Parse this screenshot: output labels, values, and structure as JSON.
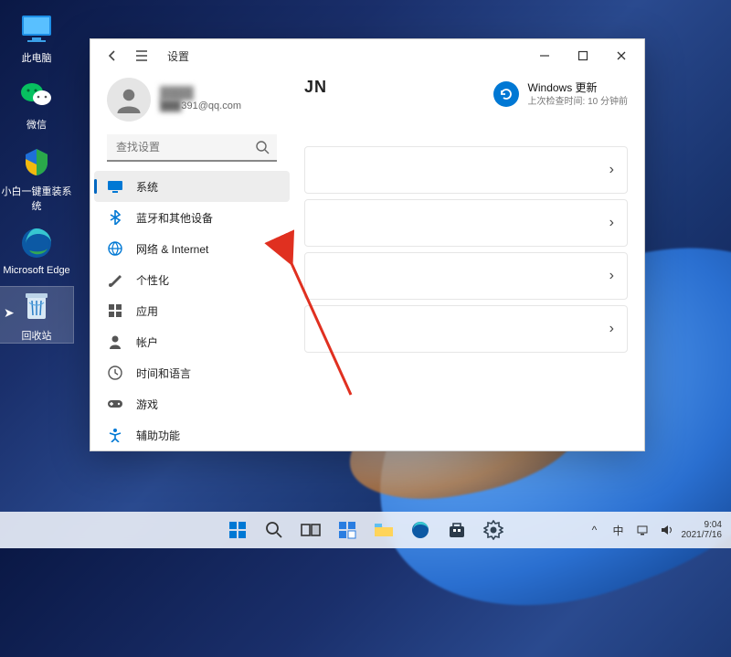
{
  "desktop": {
    "icons": [
      {
        "label": "此电脑"
      },
      {
        "label": "微信"
      },
      {
        "label": "小白一键重装系统"
      },
      {
        "label": "Microsoft Edge"
      },
      {
        "label": "回收站"
      }
    ]
  },
  "window": {
    "title": "设置",
    "profile": {
      "name_masked": "████",
      "email_suffix": "391@qq.com"
    },
    "search_placeholder": "查找设置",
    "nav": [
      {
        "label": "系统"
      },
      {
        "label": "蓝牙和其他设备"
      },
      {
        "label": "网络 & Internet"
      },
      {
        "label": "个性化"
      },
      {
        "label": "应用"
      },
      {
        "label": "帐户"
      },
      {
        "label": "时间和语言"
      },
      {
        "label": "游戏"
      },
      {
        "label": "辅助功能"
      }
    ],
    "main": {
      "device": "JN",
      "update_title": "Windows 更新",
      "update_sub": "上次检查时间: 10 分钟前"
    }
  },
  "taskbar": {
    "tray": {
      "ime": "中",
      "chevron": "^"
    },
    "time": "9:04",
    "date": "2021/7/16"
  }
}
